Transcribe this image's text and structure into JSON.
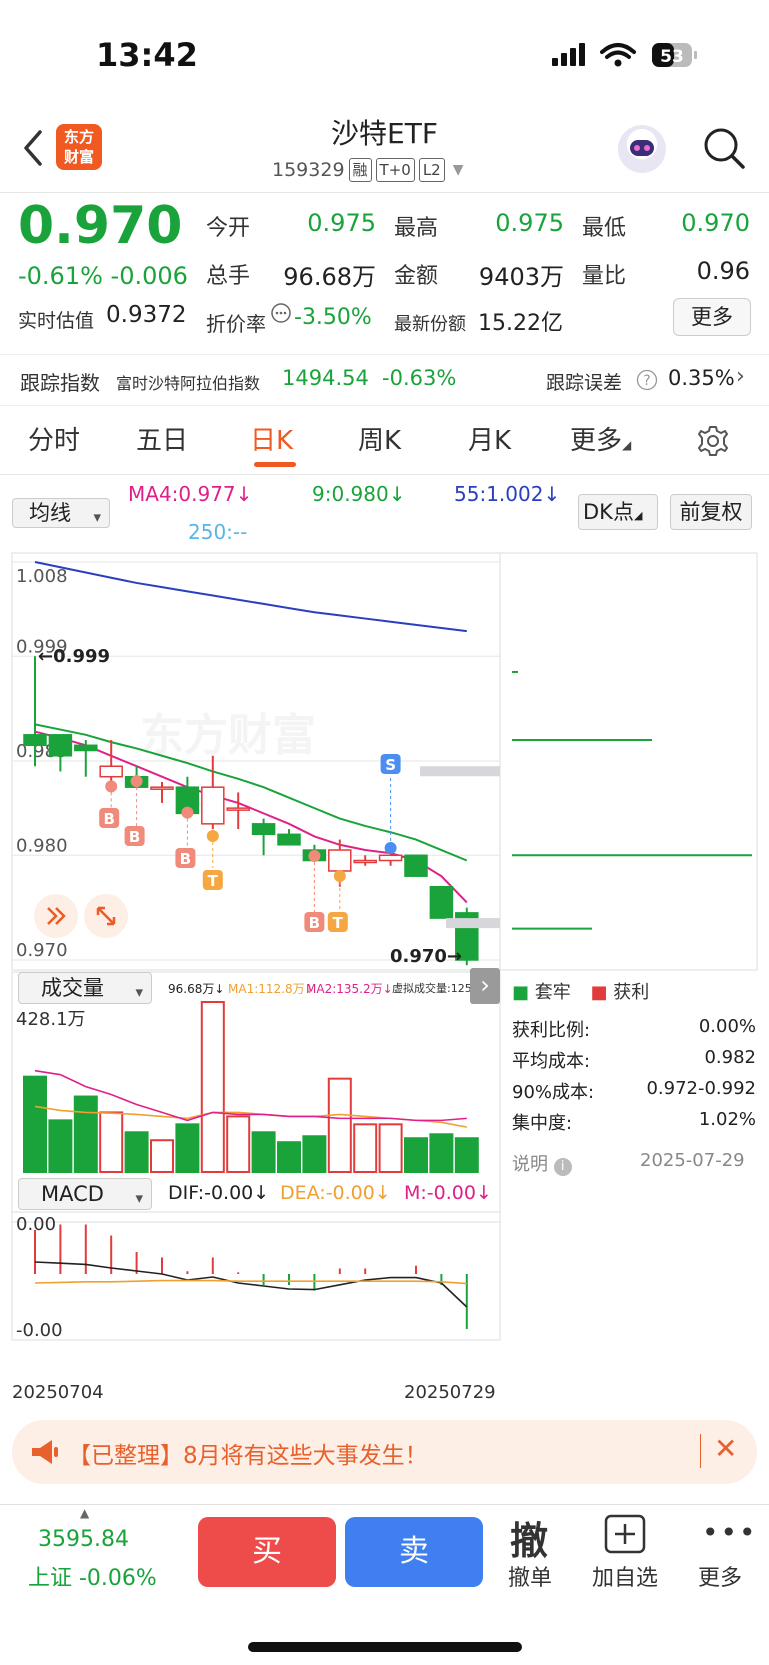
{
  "status": {
    "time": "13:42",
    "battery": "53"
  },
  "header": {
    "logo_line1": "东方",
    "logo_line2": "财富",
    "title": "沙特ETF",
    "code": "159329",
    "tags": [
      "融",
      "T+0",
      "L2"
    ]
  },
  "quote": {
    "price": "0.970",
    "change": "-0.61% -0.006",
    "fields": [
      {
        "label": "今开",
        "value": "0.975"
      },
      {
        "label": "最高",
        "value": "0.975"
      },
      {
        "label": "最低",
        "value": "0.970"
      },
      {
        "label": "总手",
        "value": "96.68万"
      },
      {
        "label": "金额",
        "value": "9403万"
      },
      {
        "label": "量比",
        "value": "0.96"
      }
    ],
    "est_label": "实时估值",
    "est_value": "0.9372",
    "premium_label": "折价率",
    "premium_value": "-3.50%",
    "shares_label": "最新份额",
    "shares_value": "15.22亿",
    "more": "更多"
  },
  "tracking": {
    "label": "跟踪指数",
    "index_name": "富时沙特阿拉伯指数",
    "index_value": "1494.54",
    "index_change": "-0.63%",
    "error_label": "跟踪误差",
    "error_value": "0.35%"
  },
  "tabs": [
    {
      "label": "分时",
      "active": false
    },
    {
      "label": "五日",
      "active": false
    },
    {
      "label": "日K",
      "active": true
    },
    {
      "label": "周K",
      "active": false
    },
    {
      "label": "月K",
      "active": false
    },
    {
      "label": "更多",
      "active": false
    }
  ],
  "indicator_bar": {
    "ma_select": "均线",
    "ma4": "MA4:0.977↓",
    "ma9": "9:0.980↓",
    "ma55": "55:1.002↓",
    "ma250": "250:--",
    "dk_button": "DK点",
    "fq_button": "前复权"
  },
  "kline": {
    "y_labels": [
      "1.008",
      "0.999",
      "0.989",
      "0.980",
      "0.970"
    ],
    "high_marker": "←0.999",
    "low_marker": "0.970→",
    "signal_labels": {
      "buy": "B",
      "sell": "S",
      "take": "T"
    },
    "watermark": "东方财富"
  },
  "volume": {
    "select": "成交量",
    "vol": "96.68万↓",
    "ma1": "MA1:112.8万↓",
    "ma2": "MA2:135.2万↓",
    "virtual": "虚拟成交量:125.7万",
    "max_label": "428.1万"
  },
  "macd": {
    "select": "MACD",
    "dif": "DIF:-0.00↓",
    "dea": "DEA:-0.00↓",
    "m": "M:-0.00↓",
    "top_label": "0.00",
    "bottom_label": "-0.00",
    "date_start": "20250704",
    "date_end": "20250729"
  },
  "chip": {
    "legend_trapped": "套牢",
    "legend_profit": "获利",
    "rows": [
      {
        "label": "获利比例:",
        "value": "0.00%"
      },
      {
        "label": "平均成本:",
        "value": "0.982"
      },
      {
        "label": "90%成本:",
        "value": "0.972-0.992"
      },
      {
        "label": "集中度:",
        "value": "1.02%"
      }
    ],
    "note_label": "说明",
    "date": "2025-07-29"
  },
  "notice": {
    "text": "【已整理】8月将有这些大事发生！"
  },
  "bottom": {
    "index_value": "3595.84",
    "index_label": "上证 -0.06%",
    "buy": "买",
    "sell": "卖",
    "cancel_glyph": "撤",
    "cancel": "撤单",
    "add": "加自选",
    "more": "更多"
  },
  "colors": {
    "up": "#e23b3b",
    "down": "#1aa33a",
    "accent": "#f05a22",
    "ma4": "#e0208a",
    "ma9": "#1aa33a",
    "ma55": "#2a3fbf"
  },
  "chart_data": {
    "type": "candlestick",
    "ylim": [
      0.97,
      1.008
    ],
    "x": [
      "20250704",
      "20250729"
    ],
    "candles": [
      {
        "o": 0.9915,
        "h": 0.999,
        "l": 0.9885,
        "c": 0.9905
      },
      {
        "o": 0.9915,
        "h": 0.9915,
        "l": 0.988,
        "c": 0.9895
      },
      {
        "o": 0.9905,
        "h": 0.991,
        "l": 0.9875,
        "c": 0.99
      },
      {
        "o": 0.9875,
        "h": 0.991,
        "l": 0.986,
        "c": 0.9885
      },
      {
        "o": 0.9875,
        "h": 0.9885,
        "l": 0.9865,
        "c": 0.9865
      },
      {
        "o": 0.9865,
        "h": 0.987,
        "l": 0.985,
        "c": 0.9865
      },
      {
        "o": 0.9865,
        "h": 0.9875,
        "l": 0.9835,
        "c": 0.984
      },
      {
        "o": 0.983,
        "h": 0.9895,
        "l": 0.9825,
        "c": 0.9865
      },
      {
        "o": 0.9845,
        "h": 0.986,
        "l": 0.9825,
        "c": 0.9845
      },
      {
        "o": 0.983,
        "h": 0.9835,
        "l": 0.98,
        "c": 0.982
      },
      {
        "o": 0.982,
        "h": 0.9825,
        "l": 0.981,
        "c": 0.981
      },
      {
        "o": 0.9805,
        "h": 0.981,
        "l": 0.9795,
        "c": 0.9795
      },
      {
        "o": 0.9785,
        "h": 0.9815,
        "l": 0.977,
        "c": 0.9805
      },
      {
        "o": 0.9795,
        "h": 0.98,
        "l": 0.979,
        "c": 0.9795
      },
      {
        "o": 0.9795,
        "h": 0.9805,
        "l": 0.979,
        "c": 0.98
      },
      {
        "o": 0.98,
        "h": 0.98,
        "l": 0.978,
        "c": 0.978
      },
      {
        "o": 0.977,
        "h": 0.977,
        "l": 0.974,
        "c": 0.974
      },
      {
        "o": 0.9745,
        "h": 0.975,
        "l": 0.9695,
        "c": 0.97
      }
    ],
    "ma4": [
      0.9918,
      0.9912,
      0.9905,
      0.9895,
      0.9885,
      0.9875,
      0.9865,
      0.9857,
      0.985,
      0.984,
      0.983,
      0.9818,
      0.981,
      0.9805,
      0.9802,
      0.9795,
      0.978,
      0.9755
    ],
    "ma9": [
      0.9925,
      0.992,
      0.9915,
      0.9908,
      0.9902,
      0.9895,
      0.9888,
      0.988,
      0.9873,
      0.9865,
      0.9855,
      0.9845,
      0.9835,
      0.9828,
      0.9822,
      0.9815,
      0.9805,
      0.9795
    ],
    "ma55": [
      1.008,
      1.0075,
      1.007,
      1.0065,
      1.006,
      1.0056,
      1.0052,
      1.0048,
      1.0044,
      1.004,
      1.0036,
      1.0032,
      1.0029,
      1.0026,
      1.0023,
      1.002,
      1.0017,
      1.0014
    ],
    "volume": [
      240,
      130,
      190,
      150,
      100,
      80,
      120,
      428,
      140,
      100,
      75,
      90,
      235,
      120,
      120,
      85,
      95,
      85
    ],
    "volume_ma1": [
      165,
      155,
      150,
      148,
      145,
      140,
      135,
      150,
      150,
      145,
      140,
      140,
      145,
      140,
      135,
      130,
      125,
      113
    ],
    "volume_ma2": [
      255,
      245,
      215,
      195,
      170,
      150,
      130,
      150,
      145,
      145,
      140,
      140,
      135,
      135,
      135,
      130,
      130,
      135
    ],
    "macd_bars": [
      0.8,
      0.9,
      0.9,
      0.7,
      0.4,
      0.3,
      0.05,
      0.3,
      0.03,
      -0.2,
      -0.2,
      -0.3,
      0.1,
      0.1,
      0.0,
      0.15,
      -0.2,
      -1.0
    ],
    "dif": [
      -0.1,
      -0.12,
      -0.14,
      -0.2,
      -0.25,
      -0.3,
      -0.4,
      -0.35,
      -0.45,
      -0.5,
      -0.55,
      -0.56,
      -0.48,
      -0.4,
      -0.36,
      -0.36,
      -0.45,
      -0.85
    ],
    "dea": [
      -0.45,
      -0.44,
      -0.43,
      -0.43,
      -0.42,
      -0.41,
      -0.41,
      -0.41,
      -0.42,
      -0.42,
      -0.42,
      -0.42,
      -0.42,
      -0.42,
      -0.42,
      -0.42,
      -0.43,
      -0.46
    ],
    "chip_levels": [
      0.9975,
      0.991,
      0.98,
      0.973
    ]
  }
}
